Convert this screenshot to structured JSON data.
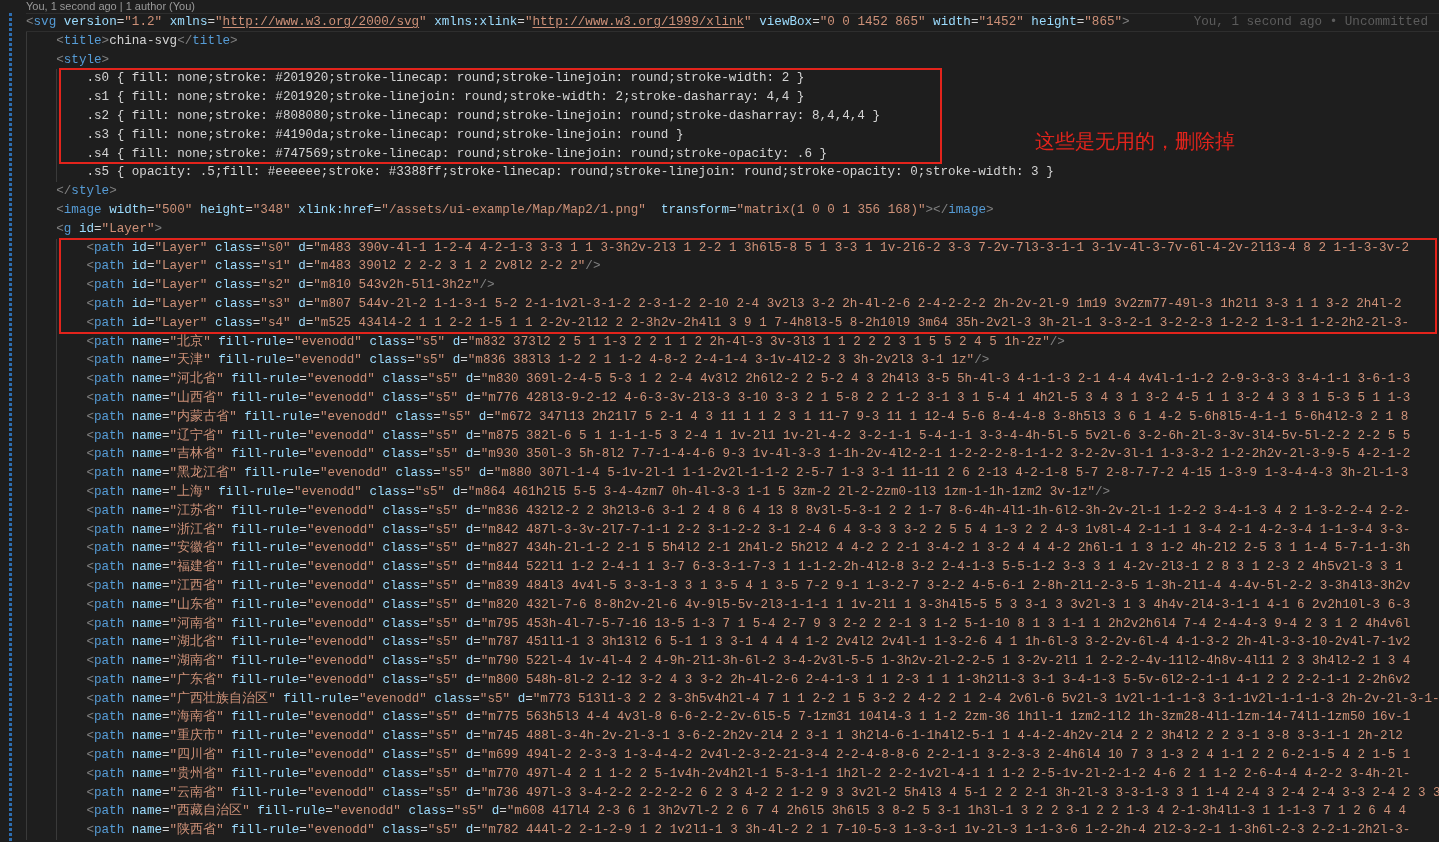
{
  "editor": {
    "codelens": "You, 1 second ago | 1 author (You)",
    "lines": [
      {
        "text": "<svg version=\"1.2\" xmlns=\"http://www.w3.org/2000/svg\" xmlns:xlink=\"http://www.w3.org/1999/xlink\" viewBox=\"0 0 1452 865\" width=\"1452\" height=\"865\">",
        "blame": "You, 1 second ago • Uncommitted",
        "current": true,
        "marked": false,
        "children": [
          {
            "text": "<title>china-svg</title>",
            "current": false,
            "marked": false
          },
          {
            "text": "<style>",
            "current": false,
            "marked": false,
            "children": [
              {
                "text": ".s0 { fill: none;stroke: #201920;stroke-linecap: round;stroke-linejoin: round;stroke-width: 2 }",
                "current": false,
                "marked": true
              },
              {
                "text": ".s1 { fill: none;stroke: #201920;stroke-linejoin: round;stroke-width: 2;stroke-dasharray: 4,4 }",
                "current": false,
                "marked": true
              },
              {
                "text": ".s2 { fill: none;stroke: #808080;stroke-linecap: round;stroke-linejoin: round;stroke-dasharray: 8,4,4,4 }",
                "current": false,
                "marked": true
              },
              {
                "text": ".s3 { fill: none;stroke: #4190da;stroke-linecap: round;stroke-linejoin: round }",
                "current": false,
                "marked": true
              },
              {
                "text": ".s4 { fill: none;stroke: #747569;stroke-linecap: round;stroke-linejoin: round;stroke-opacity: .6 }",
                "current": false,
                "marked": true
              },
              {
                "text": ".s5 { opacity: .5;fill: #eeeeee;stroke: #3388ff;stroke-linecap: round;stroke-linejoin: round;stroke-opacity: 0;stroke-width: 3 }",
                "current": false,
                "marked": false
              }
            ]
          },
          {
            "text": "</style>",
            "current": false,
            "marked": false
          },
          {
            "text": "<image width=\"500\" height=\"348\" xlink:href=\"/assets/ui-example/Map/Map2/1.png\"  transform=\"matrix(1 0 0 1 356 168)\"></image>",
            "current": false,
            "marked": false
          },
          {
            "text": "<g id=\"Layer\">",
            "current": false,
            "marked": false,
            "children": [
              {
                "text": "<path id=\"Layer\" class=\"s0\" d=\"m483 390v-4l-1 1-2-4 4-2-1-3 3-3 1 1 3-3h2v-2l3 1 2-2 1 3h6l5-8 5 1 3-3 1 1v-2l6-2 3-3 7-2v-7l3-3-1-1 3-1v-4l-3-7v-6l-4-2v-2l13-4 8 2 1-1-3-3v-2",
                "current": false,
                "marked": true
              },
              {
                "text": "<path id=\"Layer\" class=\"s1\" d=\"m483 390l2 2 2-2 3 1 2 2v8l2 2-2 2\"/>",
                "current": false,
                "marked": true
              },
              {
                "text": "<path id=\"Layer\" class=\"s2\" d=\"m810 543v2h-5l1-3h2z\"/>",
                "current": false,
                "marked": true
              },
              {
                "text": "<path id=\"Layer\" class=\"s3\" d=\"m807 544v-2l-2 1-1-3-1 5-2 2-1-1v2l-3-1-2 2-3-1-2 2-10 2-4 3v2l3 3-2 2h-4l-2-6 2-4-2-2-2 2h-2v-2l-9 1m19 3v2zm77-49l-3 1h2l1 3-3 1 1 3-2 2h4l-2",
                "current": false,
                "marked": true
              },
              {
                "text": "<path id=\"Layer\" class=\"s4\" d=\"m525 434l4-2 1 1 2-2 1-5 1 1 2-2v-2l12 2 2-3h2v-2h4l1 3 9 1 7-4h8l3-5 8-2h10l9 3m64 35h-2v2l-3 3h-2l-1 3-3-2-1 3-2-2-3 1-2-2 1-3-1 1-2-2h2-2l-3-",
                "current": false,
                "marked": true
              },
              {
                "text": "<path name=\"北京\" fill-rule=\"evenodd\" class=\"s5\" d=\"m832 373l2 2 5 1 1-3 2 2 1 1 2 2h-4l-3 3v-3l3 1 1 2 2 2 3 1 5 5 2 4 5 1h-2z\"/>",
                "current": false,
                "marked": false
              },
              {
                "text": "<path name=\"天津\" fill-rule=\"evenodd\" class=\"s5\" d=\"m836 383l3 1-2 2 1 1-2 4-8-2 2-4-1-4 3-1v-4l2-2 3 3h-2v2l3 3-1 1z\"/>",
                "current": false,
                "marked": false
              },
              {
                "text": "<path name=\"河北省\" fill-rule=\"evenodd\" class=\"s5\" d=\"m830 369l-2-4-5 5-3 1 2 2-4 4v3l2 2h6l2-2 2 5-2 4 3 2h4l3 3-5 5h-4l-3 4-1-1-3 2-1 4-4 4v4l-1-1-2 2-9-3-3-3 3-4-1-1 3-6-1-3",
                "current": false,
                "marked": false
              },
              {
                "text": "<path name=\"山西省\" fill-rule=\"evenodd\" class=\"s5\" d=\"m776 428l3-9-2-12 4-6-3-3v-2l3-3 3-10 3-3 2 1 5-8 2 2 1-2 3-1 3 1 5-4 1 4h2l-5 3 4 3 1 3-2 4-5 1 1 3-2 4 3 3 1 5-3 5 1 1-3",
                "current": false,
                "marked": false
              },
              {
                "text": "<path name=\"内蒙古省\" fill-rule=\"evenodd\" class=\"s5\" d=\"m672 347l13 2h21l7 5 2-1 4 3 11 1 1 2 3 1 11-7 9-3 11 1 12-4 5-6 8-4-4-8 3-8h5l3 3 6 1 4-2 5-6h8l5-4-1-1 5-6h4l2-3 2 1 8",
                "current": false,
                "marked": false
              },
              {
                "text": "<path name=\"辽宁省\" fill-rule=\"evenodd\" class=\"s5\" d=\"m875 382l-6 5 1 1-1-1-5 3 2-4 1 1v-2l1 1v-2l-4-2 3-2-1-1 5-4-1-1 3-3-4-4h-5l-5 5v2l-6 3-2-6h-2l-3-3v-3l4-5v-5l-2-2 2-2 5 5",
                "current": false,
                "marked": false
              },
              {
                "text": "<path name=\"吉林省\" fill-rule=\"evenodd\" class=\"s5\" d=\"m930 350l-3 5h-8l2 7-7-1-4-4-6 9-3 1v-4l-3-3 1-1h-2v-4l2-2-1 1-2-2-2-8-1-1-2 3-2-2v-3l-1 1-3-3-2 1-2-2h2v-2l-3-9-5 4-2-1-2",
                "current": false,
                "marked": false
              },
              {
                "text": "<path name=\"黑龙江省\" fill-rule=\"evenodd\" class=\"s5\" d=\"m880 307l-1-4 5-1v-2l-1 1-1-2v2l-1-1-2 2-5-7 1-3 3-1 11-11 2 6 2-13 4-2-1-8 5-7 2-8-7-7-2 4-15 1-3-9 1-3-4-4-3 3h-2l-1-3",
                "current": false,
                "marked": false
              },
              {
                "text": "<path name=\"上海\" fill-rule=\"evenodd\" class=\"s5\" d=\"m864 461h2l5 5-5 3-4-4zm7 0h-4l-3-3 1-1 5 3zm-2 2l-2-2zm0-1l3 1zm-1-1h-1zm2 3v-1z\"/>",
                "current": false,
                "marked": false
              },
              {
                "text": "<path name=\"江苏省\" fill-rule=\"evenodd\" class=\"s5\" d=\"m836 432l2-2 2 3h2l3-6 3-1 2 4 8 6 4 13 8 8v3l-5-3-1 2 2 1-7 8-6-4h-4l1-1h-6l2-3h-2v-2l-1 1-2-2 3-4-1-3 4 2 1-3-2-2-4 2-2-",
                "current": false,
                "marked": false
              },
              {
                "text": "<path name=\"浙江省\" fill-rule=\"evenodd\" class=\"s5\" d=\"m842 487l-3-3v-2l7-7-1-1 2-2 3-1-2-2 3-1 2-4 6 4 3-3 3 3-2 2 5 5 4 1-3 2 2 4-3 1v8l-4 2-1-1 1 3-4 2-1 4-2-3-4 1-1-3-4 3-3-",
                "current": false,
                "marked": false
              },
              {
                "text": "<path name=\"安徽省\" fill-rule=\"evenodd\" class=\"s5\" d=\"m827 434h-2l-1-2 2-1 5 5h4l2 2-1 2h4l-2 5h2l2 4 4-2 2 2-1 3-4-2 1 3-2 4 4 4-2 2h6l-1 1 3 1-2 4h-2l2 2-5 3 1 1-4 5-7-1-1-3h",
                "current": false,
                "marked": false
              },
              {
                "text": "<path name=\"福建省\" fill-rule=\"evenodd\" class=\"s5\" d=\"m844 522l1 1-2 2-4-1 1 3-7 6-3-3-1-7-3 1 1-1-2-2h-4l2-8 3-2 2-4-1-3 5-5-1-2 3-3 3 1 4-2v-2l3-1 2 8 3 1 2-3 2 4h5v2l-3 3 1",
                "current": false,
                "marked": false
              },
              {
                "text": "<path name=\"江西省\" fill-rule=\"evenodd\" class=\"s5\" d=\"m839 484l3 4v4l-5 3-3-1-3 3 1 3-5 4 1 3-5 7-2 9-1 1-3-2-7 3-2-2 4-5-6-1 2-8h-2l1-2-3-5 1-3h-2l1-4 4-4v-5l-2-2 3-3h4l3-3h2v",
                "current": false,
                "marked": false
              },
              {
                "text": "<path name=\"山东省\" fill-rule=\"evenodd\" class=\"s5\" d=\"m820 432l-7-6 8-8h2v-2l-6 4v-9l5-5v-2l3-1-1-1 1 1v-2l1 1 3-3h4l5-5 5 3 3-1 3 3v2l-3 1 3 4h4v-2l4-3-1-1 4-1 6 2v2h10l-3 6-3",
                "current": false,
                "marked": false
              },
              {
                "text": "<path name=\"河南省\" fill-rule=\"evenodd\" class=\"s5\" d=\"m795 453h-4l-7-5-7-16 13-5 1-3 7 1 5-4 2-7 9 3 2-2 2 2-1 3 1-2 5-1-10 8 1 3 1-1 1 2h2v2h6l4 7-4 2-4-4-3 9-4 2 3 1 2 4h4v6l",
                "current": false,
                "marked": false
              },
              {
                "text": "<path name=\"湖北省\" fill-rule=\"evenodd\" class=\"s5\" d=\"m787 451l1-1 3 3h13l2 6 5-1 1 3 3-1 4 4 4 1-2 2v4l2 2v4l-1 1-3-2-6 4 1 1h-6l-3 3-2-2v-6l-4 4-1-3-2 2h-4l-3-3-10-2v4l-7-1v2",
                "current": false,
                "marked": false
              },
              {
                "text": "<path name=\"湖南省\" fill-rule=\"evenodd\" class=\"s5\" d=\"m790 522l-4 1v-4l-4 2 4-9h-2l1-3h-6l-2 3-4-2v3l-5-5 1-3h2v-2l-2-2-5 1 3-2v-2l1 1 2-2-2-4v-11l2-4h8v-4l11 2 3 3h4l2-2 1 3 4",
                "current": false,
                "marked": false
              },
              {
                "text": "<path name=\"广东省\" fill-rule=\"evenodd\" class=\"s5\" d=\"m800 548h-8l-2 2-12 3-2 4 3 3-2 2h-4l-2-6 2-4-1-3 1 1 2-3 1 1 1-3h2l1-3 3-1 3-4-1-3 5-5v-6l2-2-1-1 4-1 2 2 2-2-1-1 2-2h6v2",
                "current": false,
                "marked": false
              },
              {
                "text": "<path name=\"广西壮族自治区\" fill-rule=\"evenodd\" class=\"s5\" d=\"m773 513l1-3 2 2 3-3h5v4h2l-4 7 1 1 2-2 1 5 3-2 2 4-2 2 1 2-4 2v6l-6 5v2l-3 1v2l-1-1-1-3 3-1-1v2l-1-1-1-3 2h-2v-2l-3-1-",
                "current": false,
                "marked": false
              },
              {
                "text": "<path name=\"海南省\" fill-rule=\"evenodd\" class=\"s5\" d=\"m775 563h5l3 4-4 4v3l-8 6-6-2-2-2v-6l5-5 7-1zm31 104l4-3 1 1-2 2zm-36 1h1l-1 1zm2-1l2 1h-3zm28-4l1-1zm-14-74l1-1zm50 16v-1",
                "current": false,
                "marked": false
              },
              {
                "text": "<path name=\"重庆市\" fill-rule=\"evenodd\" class=\"s5\" d=\"m745 488l-3-4h-2v-2l-3-1 3-6-2-2h2v-2l4 2 3-1 1 3h2l4-6-1-1h4l2-5-1 1 4-4-2-4h2v-2l4 2 2 3h4l2 2 2 3-1 3-8 3-3-1-1 2h-2l2",
                "current": false,
                "marked": false
              },
              {
                "text": "<path name=\"四川省\" fill-rule=\"evenodd\" class=\"s5\" d=\"m699 494l-2 2-3-3 1-3-4-4-2 2v4l-2-3-2-21-3-4 2-2-4-8-8-6 2-2-1-1 3-2-3-3 2-4h6l4 10 7 3 1-3 2 4 1-1 2 2 6-2-1-5 4 2 1-5 1",
                "current": false,
                "marked": false
              },
              {
                "text": "<path name=\"贵州省\" fill-rule=\"evenodd\" class=\"s5\" d=\"m770 497l-4 2 1 1-2 2 5-1v4h-2v4h2l-1 5-3-1-1 1h2l-2 2-2-1v2l-4-1 1 1-2 2-5-1v-2l-2-1-2 4-6 2 1 1-2 2-6-4-4 4-2-2 3-4h-2l-",
                "current": false,
                "marked": false
              },
              {
                "text": "<path name=\"云南省\" fill-rule=\"evenodd\" class=\"s5\" d=\"m736 497l-3 3-4-2-2 2-2-2-2 6 2 3 4-2 2 1-2 9 3 3v2l-2 5h4l3 4 5-1 2 2 2-1 3h-2l-3 3-3-1-3 3 1 1-4 2-4 3 2-4 2-4 3-3 2-4 2 3 3",
                "current": false,
                "marked": false
              },
              {
                "text": "<path name=\"西藏自治区\" fill-rule=\"evenodd\" class=\"s5\" d=\"m608 417l4 2-3 6 1 3h2v7l-2 2 6 7 4 2h6l5 3h6l5 3 8-2 5 3-1 1h3l-1 3 2 2 3-1 2 2 1-3 4 2-1-3h4l1-3 1 1-1-3 7 1 2 6 4 4",
                "current": false,
                "marked": false
              },
              {
                "text": "<path name=\"陕西省\" fill-rule=\"evenodd\" class=\"s5\" d=\"m782 444l-2 2-1-2-9 1 2 1v2l1-1 3 3h-4l-2 2 1 7-10-5-3 1-3-3-1 1v-2l-3 1-1-3-6 1-2-2h-4 2l2-3-2-1 1-3h6l-2-3 2-2-1-2h2l-3-",
                "current": false,
                "marked": false
              }
            ]
          }
        ]
      }
    ]
  },
  "annotation": {
    "note": "这些是无用的，删除掉"
  }
}
